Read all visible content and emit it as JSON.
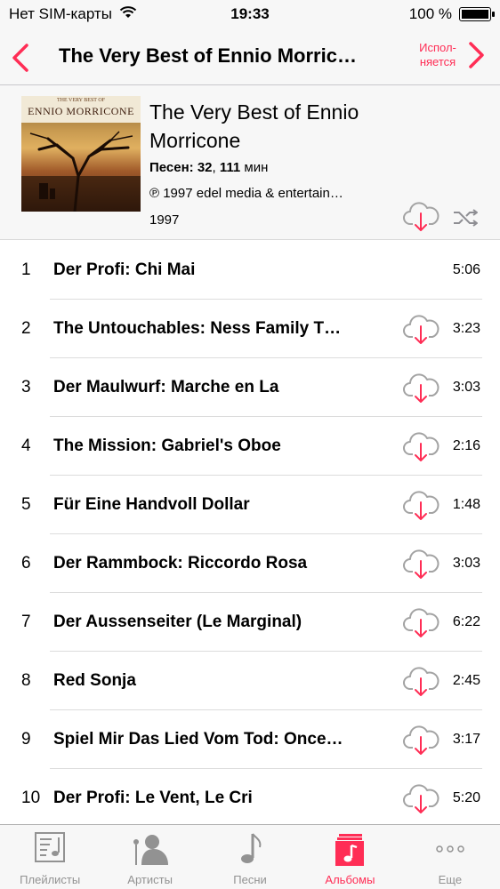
{
  "status_bar": {
    "carrier": "Нет SIM-карты",
    "time": "19:33",
    "battery": "100 %",
    "battery_level": 1.0
  },
  "nav": {
    "title": "The Very Best of Ennio Morric…",
    "now_playing_line1": "Испол-",
    "now_playing_line2": "няется",
    "accent_color": "#ff2d55"
  },
  "album": {
    "title": "The Very Best of Ennio Morricone",
    "songs_label": "Песен:",
    "songs_count": "32",
    "separator": ",",
    "duration_value": "111",
    "duration_unit": "мин",
    "copyright": "℗ 1997 edel media & entertain…",
    "year": "1997",
    "cover_subtitle": "THE VERY BEST OF",
    "cover_name": "ENNIO MORRICONE"
  },
  "tracks": [
    {
      "num": "1",
      "title": "Der Profi: Chi Mai",
      "duration": "5:06",
      "cloud": false
    },
    {
      "num": "2",
      "title": "The Untouchables: Ness Family T…",
      "duration": "3:23",
      "cloud": true
    },
    {
      "num": "3",
      "title": "Der Maulwurf: Marche en La",
      "duration": "3:03",
      "cloud": true
    },
    {
      "num": "4",
      "title": "The Mission: Gabriel's Oboe",
      "duration": "2:16",
      "cloud": true
    },
    {
      "num": "5",
      "title": "Für Eine Handvoll Dollar",
      "duration": "1:48",
      "cloud": true
    },
    {
      "num": "6",
      "title": "Der Rammbock: Riccordo Rosa",
      "duration": "3:03",
      "cloud": true
    },
    {
      "num": "7",
      "title": "Der Aussenseiter (Le Marginal)",
      "duration": "6:22",
      "cloud": true
    },
    {
      "num": "8",
      "title": "Red Sonja",
      "duration": "2:45",
      "cloud": true
    },
    {
      "num": "9",
      "title": "Spiel Mir Das Lied Vom Tod: Once…",
      "duration": "3:17",
      "cloud": true
    },
    {
      "num": "10",
      "title": "Der Profi: Le Vent, Le Cri",
      "duration": "5:20",
      "cloud": true
    }
  ],
  "tabs": [
    {
      "label": "Плейлисты",
      "icon": "playlist-icon",
      "active": false
    },
    {
      "label": "Артисты",
      "icon": "artist-icon",
      "active": false
    },
    {
      "label": "Песни",
      "icon": "music-note-icon",
      "active": false
    },
    {
      "label": "Альбомы",
      "icon": "album-icon",
      "active": true
    },
    {
      "label": "Еще",
      "icon": "more-icon",
      "active": false
    }
  ]
}
